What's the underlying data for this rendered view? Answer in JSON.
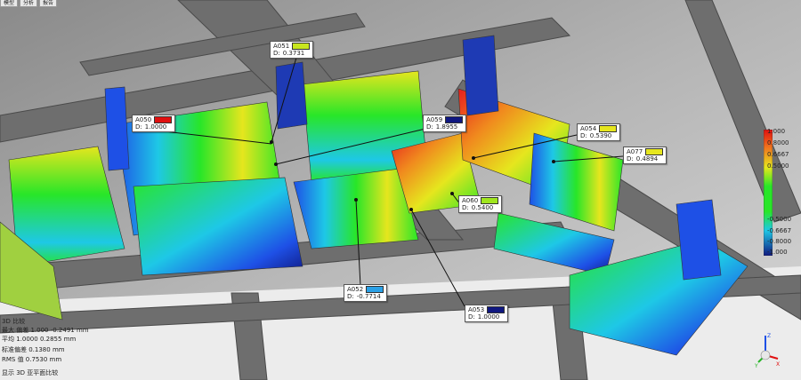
{
  "tabs": [
    "模型",
    "分析",
    "报告"
  ],
  "callouts": [
    {
      "id": "A051",
      "d": "0.3731",
      "color": "#c8e61e"
    },
    {
      "id": "A050",
      "d": "1.0000",
      "color": "#e01010"
    },
    {
      "id": "A059",
      "d": "1.8955",
      "color": "#101880"
    },
    {
      "id": "A054",
      "d": "0.5390",
      "color": "#e6e61e"
    },
    {
      "id": "A077",
      "d": "0.4894",
      "color": "#e6e61e"
    },
    {
      "id": "A060",
      "d": "0.5400",
      "color": "#a0e61e"
    },
    {
      "id": "A052",
      "d": "-0.7714",
      "color": "#2aa0e6"
    },
    {
      "id": "A053",
      "d": "1.0000",
      "color": "#101880"
    }
  ],
  "scale": {
    "labels": [
      "1.000",
      "0.8000",
      "0.6667",
      "0.5000",
      "-0.5000",
      "-0.6667",
      "-0.8000",
      "-1.000"
    ]
  },
  "status": [
    "3D 比较",
    "最大 偏差 1.000  -0.2491 mm",
    "平均 1.0000  0.2855 mm",
    "标准偏差 0.1380 mm",
    "RMS 值 0.7530 mm",
    "显示  3D  亚平面比较"
  ],
  "axes": {
    "x": "X",
    "y": "Y",
    "z": "Z"
  }
}
